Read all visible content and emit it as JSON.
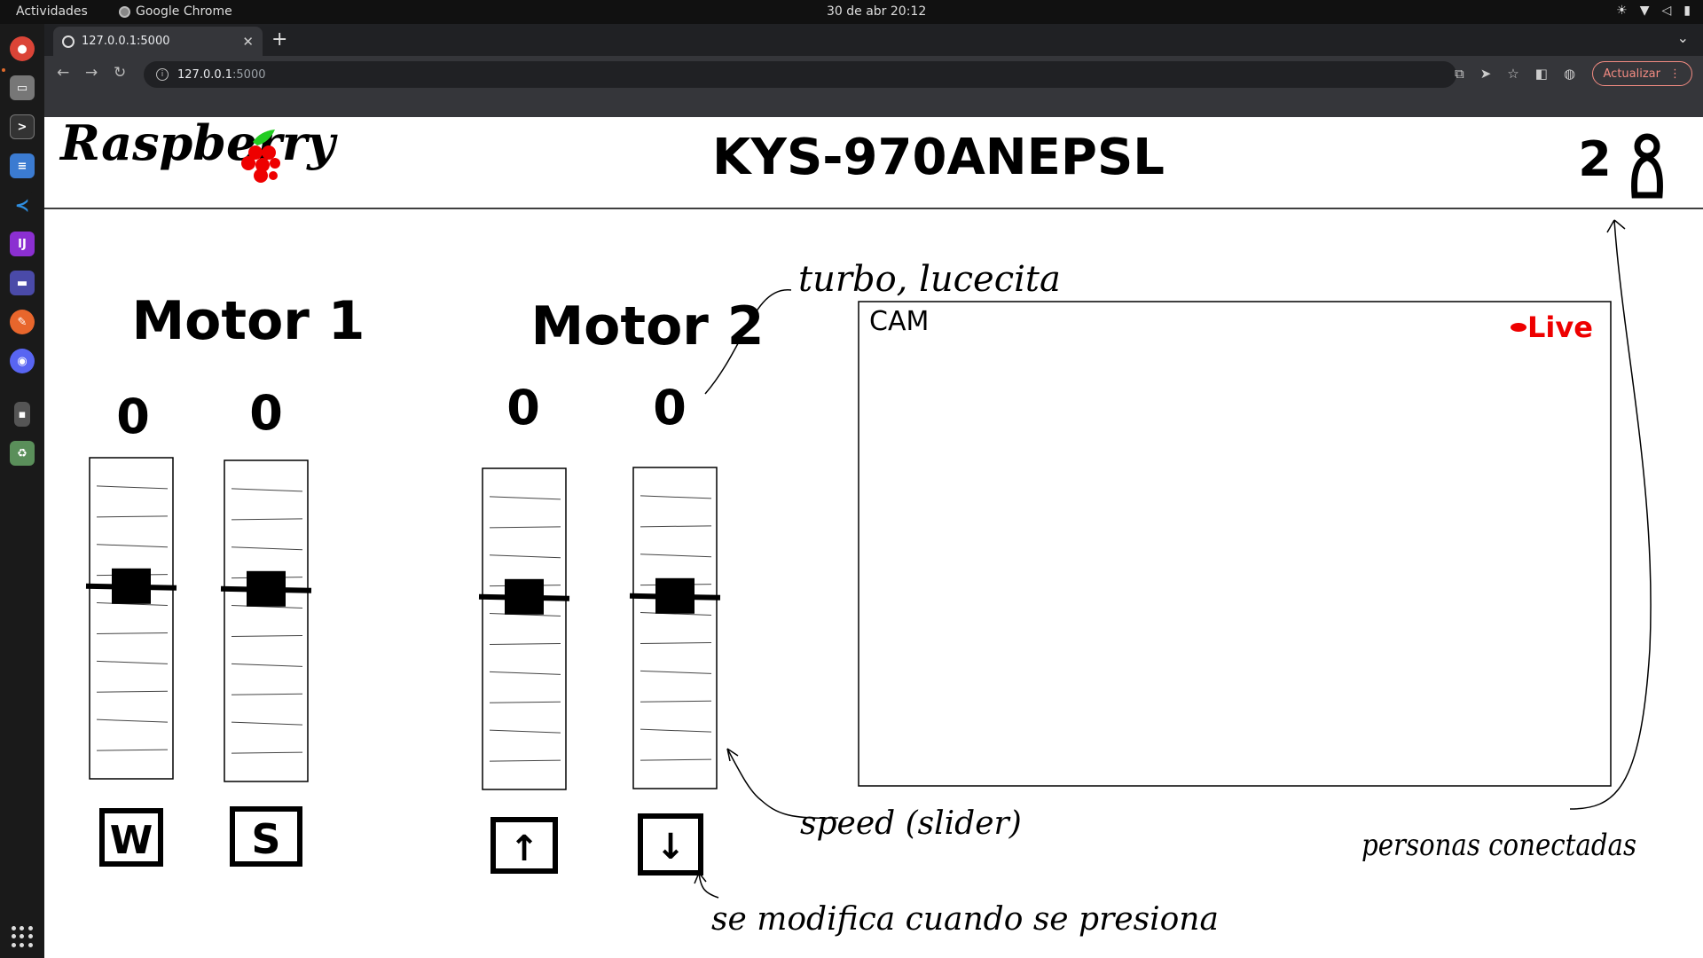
{
  "desktop": {
    "activities": "Actividades",
    "app_name": "Google Chrome",
    "clock": "30 de abr  20:12"
  },
  "browser": {
    "tab_title": "127.0.0.1:5000",
    "url_host": "127.0.0.1",
    "url_port": ":5000",
    "update_label": "Actualizar"
  },
  "page": {
    "header": {
      "logo_text": "Raspberry",
      "room_code": "KYS-970ANEPSL",
      "connected_count": "2"
    },
    "motors": [
      {
        "label": "Motor 1",
        "sliders": [
          {
            "value": "0",
            "key": "W",
            "level": 0.6
          },
          {
            "value": "0",
            "key": "S",
            "level": 0.6
          }
        ]
      },
      {
        "label": "Motor 2",
        "sliders": [
          {
            "value": "0",
            "key": "↑",
            "level": 0.6
          },
          {
            "value": "0",
            "key": "↓",
            "level": 0.6
          }
        ]
      }
    ],
    "camera": {
      "label": "CAM",
      "live_label": "Live"
    },
    "annotations": {
      "turbo": "turbo, lucecita",
      "speed": "speed (slider)",
      "pressed": "se modifica cuando se presiona",
      "connected": "personas conectadas"
    }
  }
}
